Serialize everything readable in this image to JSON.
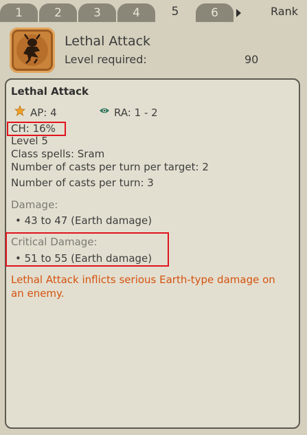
{
  "tabs": [
    {
      "label": "1",
      "active": false
    },
    {
      "label": "2",
      "active": false
    },
    {
      "label": "3",
      "active": false
    },
    {
      "label": "4",
      "active": false
    },
    {
      "label": "5",
      "active": true
    },
    {
      "label": "6",
      "active": false
    }
  ],
  "tab_nav": {
    "arrow_icon": "triangle-right-icon",
    "rank_label": "Rank"
  },
  "header": {
    "icon": "lethal-attack-spell-icon",
    "spell_name": "Lethal Attack",
    "level_required_label": "Level required:",
    "level_required_value": "90"
  },
  "details": {
    "title": "Lethal Attack",
    "ap": "AP: 4",
    "ra": "RA: 1 - 2",
    "ch": "CH: 16%",
    "level": "Level 5",
    "class_spells": "Class spells: Sram",
    "casts_per_target": "Number of casts per turn per target: 2",
    "casts_per_turn": "Number of casts per turn: 3",
    "damage_label": "Damage:",
    "damage_value": "• 43 to 47 (Earth damage)",
    "critical_label": "Critical Damage:",
    "critical_value": "• 51 to 55 (Earth damage)",
    "description": "Lethal Attack inflicts serious Earth-type damage on an enemy."
  },
  "colors": {
    "highlight_border": "#e0131d",
    "description_text": "#d4520f",
    "tab_inactive": "#8a8779",
    "background": "#d5d0bd"
  }
}
